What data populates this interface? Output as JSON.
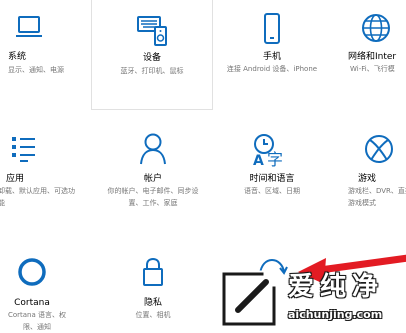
{
  "settings_tiles": [
    {
      "title": "系统",
      "desc": "显示、通知、电源"
    },
    {
      "title": "设备",
      "desc": "蓝牙、打印机、鼠标"
    },
    {
      "title": "手机",
      "desc": "连接 Android 设备、iPhone"
    },
    {
      "title": "网络和Inter",
      "desc": "Wi-Fi、飞行模"
    },
    {
      "title": "应用",
      "desc": "卸载、默认应用、可选功能"
    },
    {
      "title": "帐户",
      "desc": "你的帐户、电子邮件、同步设置、工作、家庭"
    },
    {
      "title": "时间和语言",
      "desc": "语音、区域、日期"
    },
    {
      "title": "游戏",
      "desc": "游戏栏、DVR、直播、游戏模式"
    },
    {
      "title": "Cortana",
      "desc": "Cortana 语言、权限、通知"
    },
    {
      "title": "隐私",
      "desc": "位置、相机"
    }
  ],
  "watermark": {
    "brand": "爱纯净",
    "url": "aichunjing.com"
  },
  "colors": {
    "icon_blue": "#0f6cbd",
    "arrow_red": "#e31b23",
    "desc_gray": "#767676"
  }
}
